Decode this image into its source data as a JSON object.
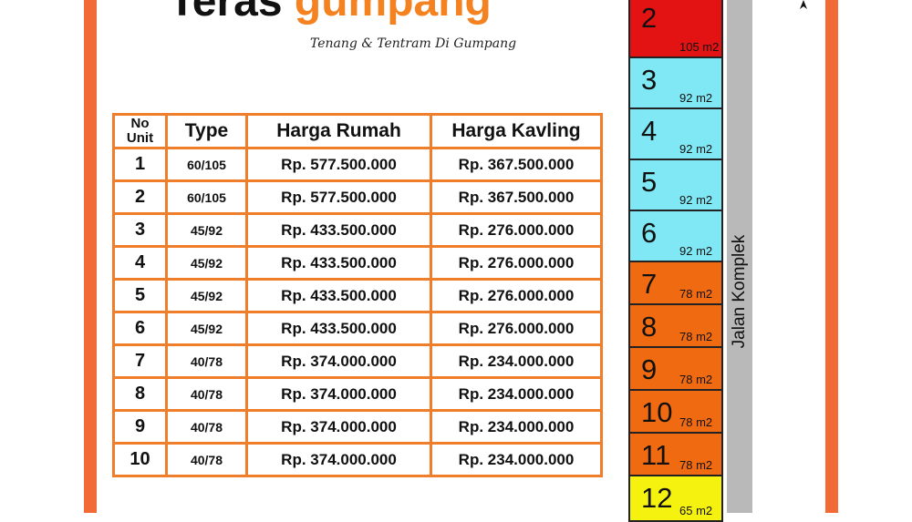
{
  "header": {
    "brand_word1": "Teras",
    "brand_word2": "gumpang",
    "tagline": "Tenang & Tentram Di Gumpang"
  },
  "table": {
    "headers": {
      "no_line1": "No",
      "no_line2": "Unit",
      "type": "Type",
      "harga_rumah": "Harga Rumah",
      "harga_kavling": "Harga Kavling"
    },
    "rows": [
      {
        "no": "1",
        "type": "60/105",
        "rumah": "Rp. 577.500.000",
        "kavling": "Rp. 367.500.000"
      },
      {
        "no": "2",
        "type": "60/105",
        "rumah": "Rp. 577.500.000",
        "kavling": "Rp. 367.500.000"
      },
      {
        "no": "3",
        "type": "45/92",
        "rumah": "Rp. 433.500.000",
        "kavling": "Rp. 276.000.000"
      },
      {
        "no": "4",
        "type": "45/92",
        "rumah": "Rp. 433.500.000",
        "kavling": "Rp. 276.000.000"
      },
      {
        "no": "5",
        "type": "45/92",
        "rumah": "Rp. 433.500.000",
        "kavling": "Rp. 276.000.000"
      },
      {
        "no": "6",
        "type": "45/92",
        "rumah": "Rp. 433.500.000",
        "kavling": "Rp. 276.000.000"
      },
      {
        "no": "7",
        "type": "40/78",
        "rumah": "Rp. 374.000.000",
        "kavling": "Rp. 234.000.000"
      },
      {
        "no": "8",
        "type": "40/78",
        "rumah": "Rp. 374.000.000",
        "kavling": "Rp. 234.000.000"
      },
      {
        "no": "9",
        "type": "40/78",
        "rumah": "Rp. 374.000.000",
        "kavling": "Rp. 234.000.000"
      },
      {
        "no": "10",
        "type": "40/78",
        "rumah": "Rp. 374.000.000",
        "kavling": "Rp. 234.000.000"
      }
    ]
  },
  "siteplan": {
    "road_label": "Jalan Komplek",
    "lots": [
      {
        "num": "2",
        "area": "105 m2",
        "color": "#e31313"
      },
      {
        "num": "3",
        "area": "92 m2",
        "color": "#7fe8f4"
      },
      {
        "num": "4",
        "area": "92 m2",
        "color": "#7fe8f4"
      },
      {
        "num": "5",
        "area": "92 m2",
        "color": "#7fe8f4"
      },
      {
        "num": "6",
        "area": "92 m2",
        "color": "#7fe8f4"
      },
      {
        "num": "7",
        "area": "78 m2",
        "color": "#f06a12"
      },
      {
        "num": "8",
        "area": "78 m2",
        "color": "#f06a12"
      },
      {
        "num": "9",
        "area": "78 m2",
        "color": "#f06a12"
      },
      {
        "num": "10",
        "area": "78 m2",
        "color": "#f06a12"
      },
      {
        "num": "11",
        "area": "78 m2",
        "color": "#f06a12"
      },
      {
        "num": "12",
        "area": "65 m2",
        "color": "#f5f20f"
      }
    ]
  },
  "colors": {
    "frame": "#f26a36",
    "table_border": "#ef7d2a",
    "brand_orange": "#f58220"
  }
}
